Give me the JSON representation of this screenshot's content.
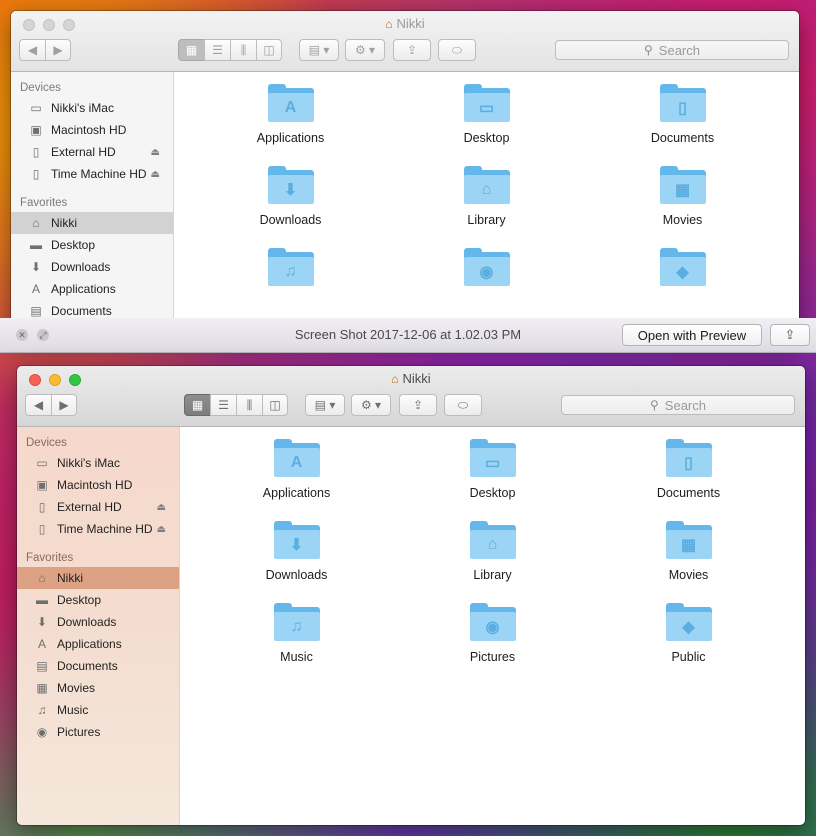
{
  "back_window": {
    "title": "Nikki",
    "search_placeholder": "Search",
    "sidebar": {
      "devices_heading": "Devices",
      "devices": [
        {
          "label": "Nikki's iMac",
          "icon": "imac-icon",
          "eject": false
        },
        {
          "label": "Macintosh HD",
          "icon": "hard-drive-icon",
          "eject": false
        },
        {
          "label": "External HD",
          "icon": "external-drive-icon",
          "eject": true
        },
        {
          "label": "Time Machine HD",
          "icon": "external-drive-icon",
          "eject": true
        }
      ],
      "favorites_heading": "Favorites",
      "favorites": [
        {
          "label": "Nikki",
          "icon": "home-icon",
          "selected": true
        },
        {
          "label": "Desktop",
          "icon": "desktop-icon",
          "selected": false
        },
        {
          "label": "Downloads",
          "icon": "downloads-icon",
          "selected": false
        },
        {
          "label": "Applications",
          "icon": "applications-icon",
          "selected": false
        },
        {
          "label": "Documents",
          "icon": "documents-icon",
          "selected": false
        }
      ]
    },
    "folders": [
      {
        "label": "Applications",
        "glyph": "applications-glyph"
      },
      {
        "label": "Desktop",
        "glyph": "desktop-glyph"
      },
      {
        "label": "Documents",
        "glyph": "documents-glyph"
      },
      {
        "label": "Downloads",
        "glyph": "downloads-glyph"
      },
      {
        "label": "Library",
        "glyph": "library-glyph"
      },
      {
        "label": "Movies",
        "glyph": "movies-glyph"
      },
      {
        "label": "",
        "glyph": "music-glyph"
      },
      {
        "label": "",
        "glyph": "pictures-glyph"
      },
      {
        "label": "",
        "glyph": "public-glyph"
      }
    ]
  },
  "quicklook": {
    "title": "Screen Shot 2017-12-06 at 1.02.03 PM",
    "open_button": "Open with Preview",
    "share_icon": "share-icon"
  },
  "front_window": {
    "title": "Nikki",
    "search_placeholder": "Search",
    "sidebar": {
      "devices_heading": "Devices",
      "devices": [
        {
          "label": "Nikki's iMac",
          "icon": "imac-icon",
          "eject": false
        },
        {
          "label": "Macintosh HD",
          "icon": "hard-drive-icon",
          "eject": false
        },
        {
          "label": "External HD",
          "icon": "external-drive-icon",
          "eject": true
        },
        {
          "label": "Time Machine HD",
          "icon": "external-drive-icon",
          "eject": true
        }
      ],
      "favorites_heading": "Favorites",
      "favorites": [
        {
          "label": "Nikki",
          "icon": "home-icon",
          "selected": true
        },
        {
          "label": "Desktop",
          "icon": "desktop-icon",
          "selected": false
        },
        {
          "label": "Downloads",
          "icon": "downloads-icon",
          "selected": false
        },
        {
          "label": "Applications",
          "icon": "applications-icon",
          "selected": false
        },
        {
          "label": "Documents",
          "icon": "documents-icon",
          "selected": false
        },
        {
          "label": "Movies",
          "icon": "movies-icon",
          "selected": false
        },
        {
          "label": "Music",
          "icon": "music-icon",
          "selected": false
        },
        {
          "label": "Pictures",
          "icon": "pictures-icon",
          "selected": false
        }
      ]
    },
    "folders": [
      {
        "label": "Applications",
        "glyph": "applications-glyph"
      },
      {
        "label": "Desktop",
        "glyph": "desktop-glyph"
      },
      {
        "label": "Documents",
        "glyph": "documents-glyph"
      },
      {
        "label": "Downloads",
        "glyph": "downloads-glyph"
      },
      {
        "label": "Library",
        "glyph": "library-glyph"
      },
      {
        "label": "Movies",
        "glyph": "movies-glyph"
      },
      {
        "label": "Music",
        "glyph": "music-glyph"
      },
      {
        "label": "Pictures",
        "glyph": "pictures-glyph"
      },
      {
        "label": "Public",
        "glyph": "public-glyph"
      }
    ]
  },
  "colors": {
    "folder_front": "#9cd4f6",
    "folder_back": "#64b7ea",
    "selection_front_window": "#dca283",
    "selection_back_window": "#d2d2d2",
    "close": "#fc5f57",
    "minimize": "#fdbc2e",
    "zoom": "#33c748"
  }
}
